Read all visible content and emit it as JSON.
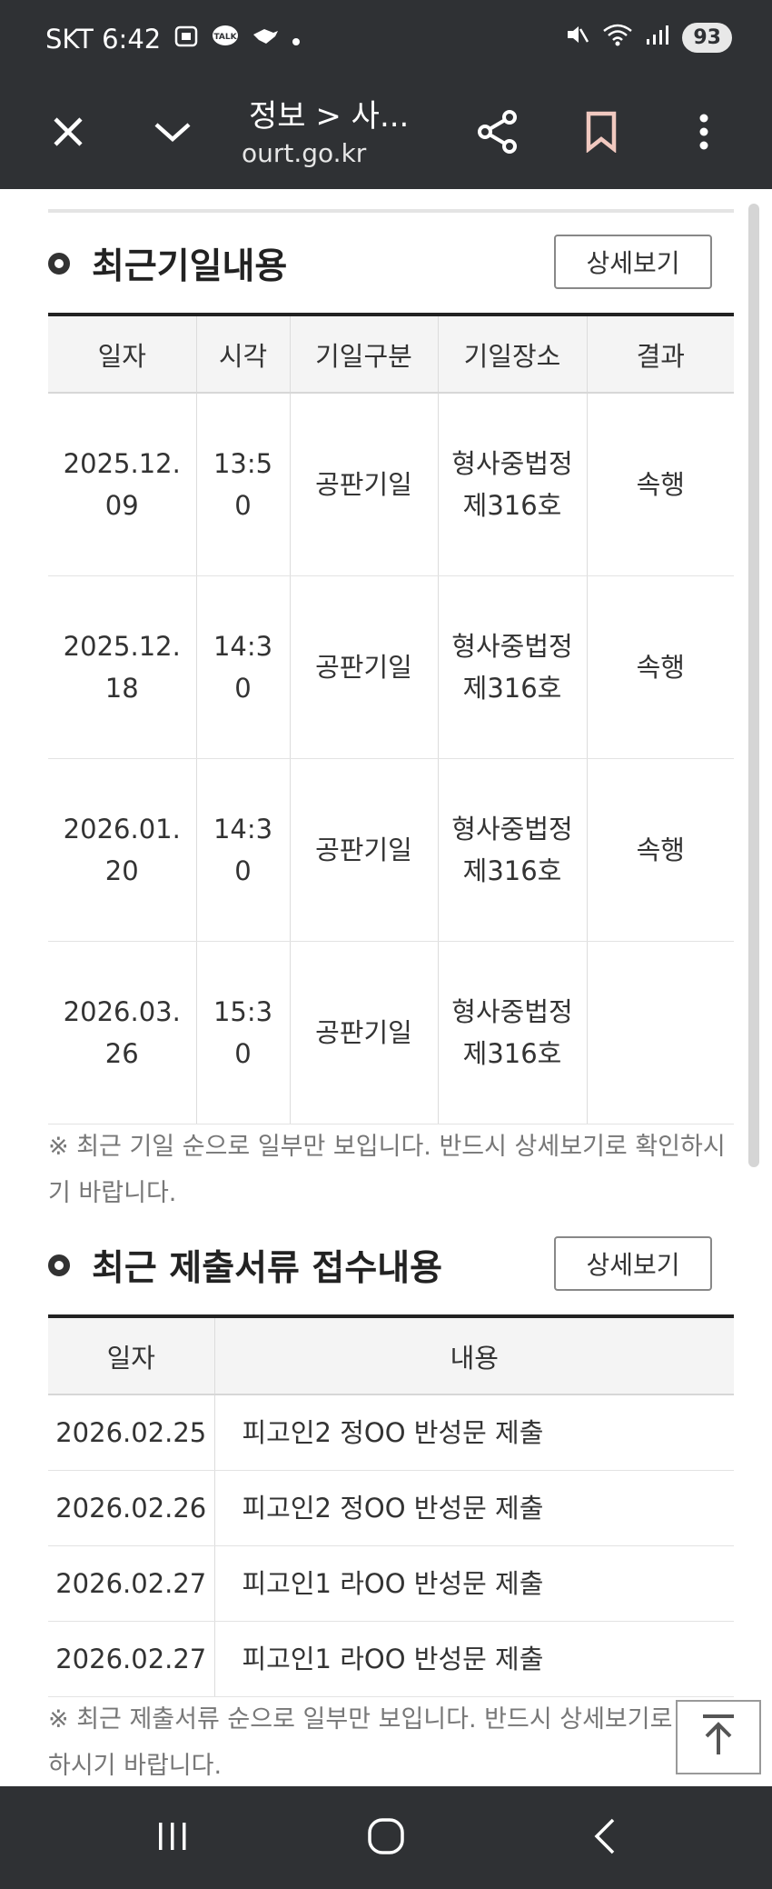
{
  "status": {
    "carrier_time": "SKT 6:42",
    "battery": "93",
    "icons": [
      "screenshot-icon",
      "talk-icon",
      "bird-icon",
      "dot-icon",
      "mute-icon",
      "wifi-icon",
      "signal-icon"
    ]
  },
  "appbar": {
    "title": "정보 > 사...",
    "url": "ourt.go.kr",
    "icons": [
      "close-icon",
      "chevron-down-icon",
      "share-icon",
      "bookmark-icon",
      "more-vertical-icon"
    ]
  },
  "hearings": {
    "title": "최근기일내용",
    "detail_button": "상세보기",
    "columns": [
      "일자",
      "시각",
      "기일구분",
      "기일장소",
      "결과"
    ],
    "rows": [
      {
        "date": "2025.12.09",
        "time": "13:50",
        "type": "공판기일",
        "place": "형사중법정 제316호",
        "result": "속행"
      },
      {
        "date": "2025.12.18",
        "time": "14:30",
        "type": "공판기일",
        "place": "형사중법정 제316호",
        "result": "속행"
      },
      {
        "date": "2026.01.20",
        "time": "14:30",
        "type": "공판기일",
        "place": "형사중법정 제316호",
        "result": "속행"
      },
      {
        "date": "2026.03.26",
        "time": "15:30",
        "type": "공판기일",
        "place": "형사중법정 제316호",
        "result": ""
      }
    ],
    "note": "※ 최근 기일 순으로 일부만 보입니다. 반드시 상세보기로 확인하시기 바랍니다."
  },
  "documents": {
    "title": "최근 제출서류 접수내용",
    "detail_button": "상세보기",
    "columns": [
      "일자",
      "내용"
    ],
    "rows": [
      {
        "date": "2026.02.25",
        "content": "피고인2 정OO 반성문 제출"
      },
      {
        "date": "2026.02.26",
        "content": "피고인2 정OO 반성문 제출"
      },
      {
        "date": "2026.02.27",
        "content": "피고인1 라OO 반성문 제출"
      },
      {
        "date": "2026.02.27",
        "content": "피고인1 라OO 반성문 제출"
      }
    ],
    "note": "※ 최근 제출서류 순으로 일부만 보입니다. 반드시 상세보기로 확인하시기 바랍니다."
  },
  "scroll_top_icon": "arrow-up-icon",
  "navbar": {
    "icons": [
      "recent-apps-icon",
      "home-icon",
      "back-icon"
    ]
  }
}
